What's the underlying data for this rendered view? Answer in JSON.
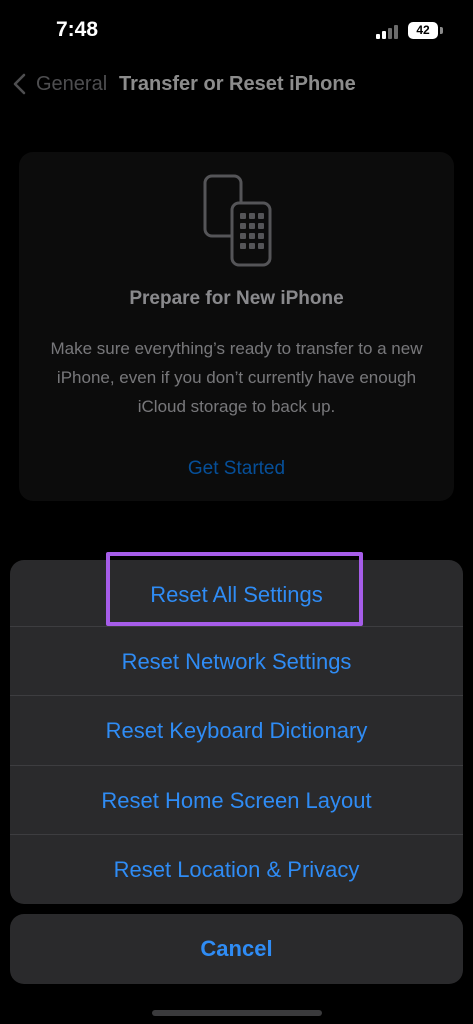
{
  "status_bar": {
    "time": "7:48",
    "battery": "42",
    "icons": [
      "signal-icon",
      "battery-icon"
    ]
  },
  "nav": {
    "back_label": "General",
    "title": "Transfer or Reset iPhone"
  },
  "card": {
    "icon": "transfer-phones-icon",
    "title": "Prepare for New iPhone",
    "description": "Make sure everything’s ready to transfer to a new iPhone, even if you don’t currently have enough iCloud storage to back up.",
    "action": "Get Started"
  },
  "action_sheet": {
    "items": [
      {
        "label": "Reset All Settings"
      },
      {
        "label": "Reset Network Settings"
      },
      {
        "label": "Reset Keyboard Dictionary"
      },
      {
        "label": "Reset Home Screen Layout"
      },
      {
        "label": "Reset Location & Privacy"
      }
    ],
    "cancel": "Cancel",
    "highlighted_item": "Reset All Settings"
  },
  "colors": {
    "accent": "#2f8cf5",
    "highlight": "#a65de9",
    "sheet_bg": "#2a2a2c"
  }
}
